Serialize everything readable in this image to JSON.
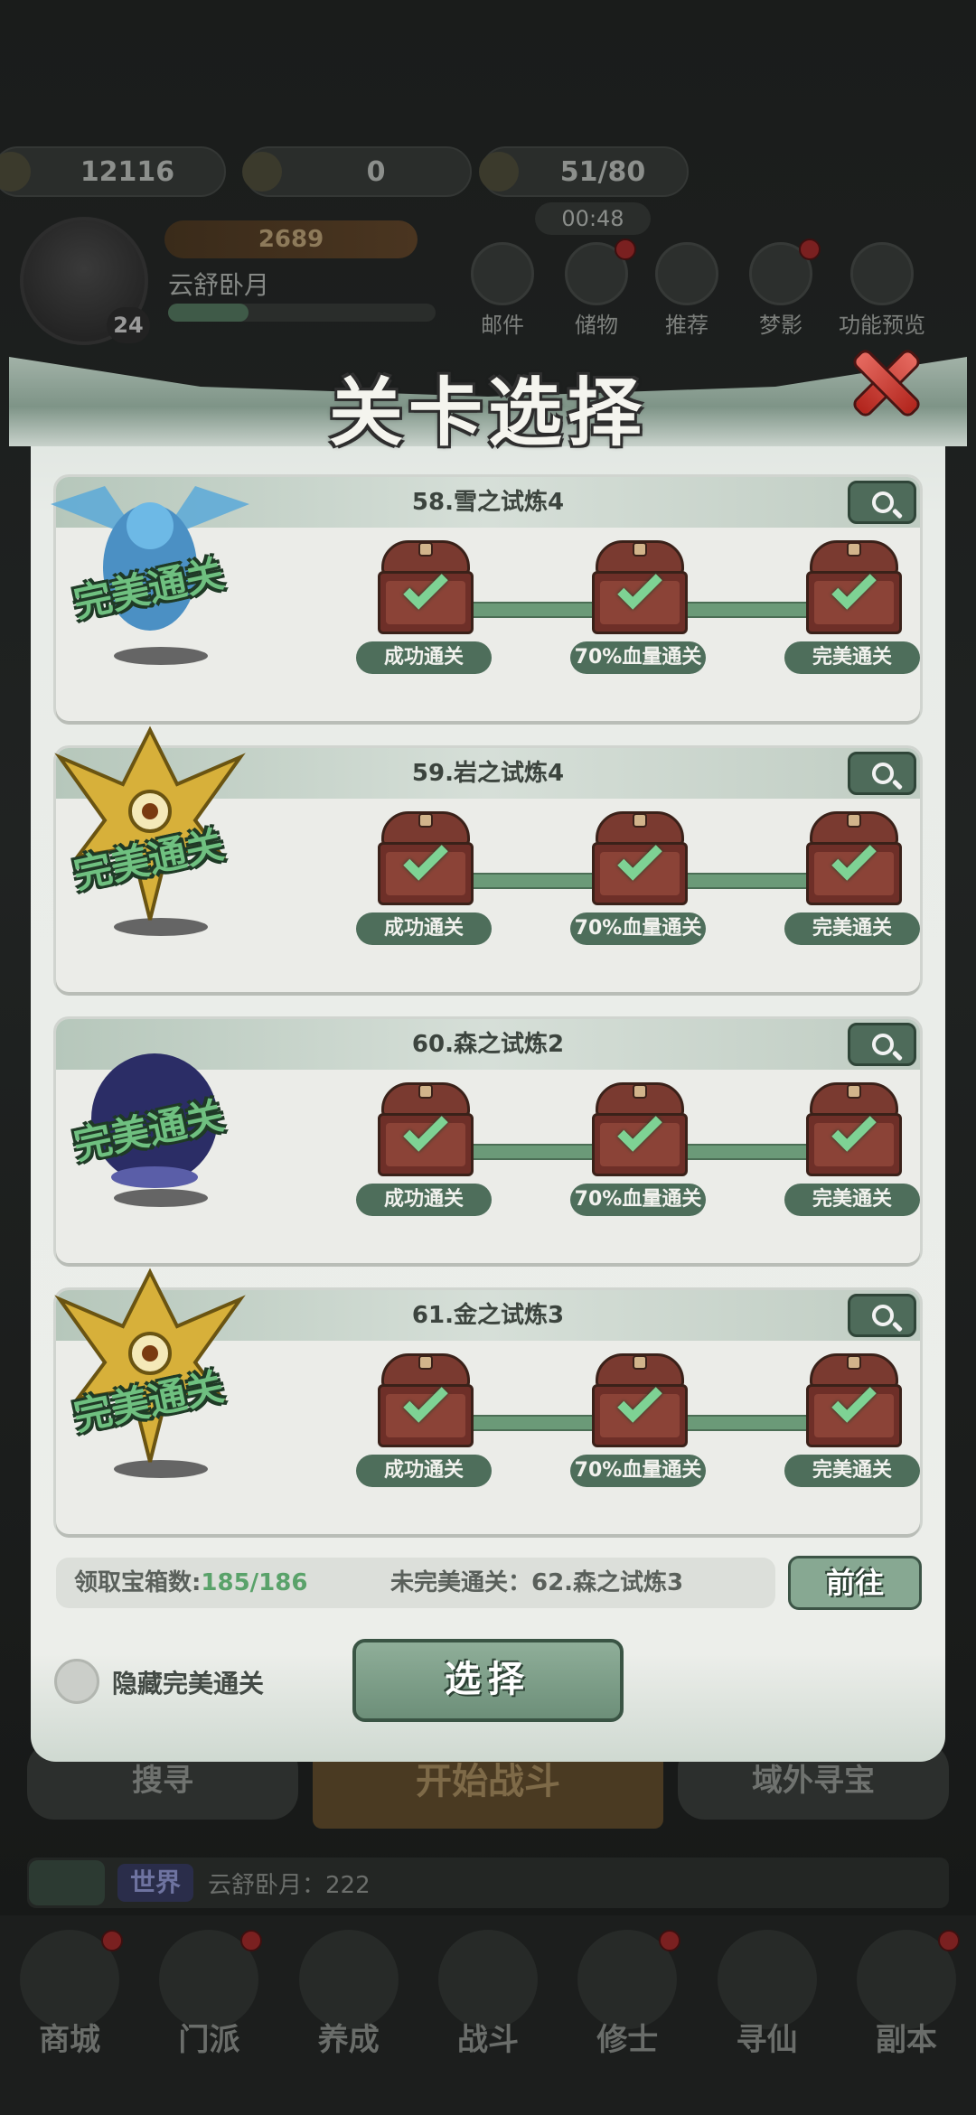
{
  "resources": [
    {
      "icon": "coin-icon",
      "value": "12116"
    },
    {
      "icon": "ticket-icon",
      "value": "0"
    },
    {
      "icon": "stamina-icon",
      "value": "51/80"
    }
  ],
  "timer": "00:48",
  "player": {
    "level": "24",
    "power": "2689",
    "name": "云舒卧月"
  },
  "top_buttons": [
    {
      "icon": "mail-icon",
      "label": "邮件"
    },
    {
      "icon": "storage-icon",
      "label": "储物"
    },
    {
      "icon": "recommend-icon",
      "label": "推荐"
    },
    {
      "icon": "dream-icon",
      "label": "梦影"
    },
    {
      "icon": "preview-icon",
      "label": "功能预览"
    }
  ],
  "battle": {
    "left_label": "搜寻",
    "start_label": "开始战斗",
    "right_label": "域外寻宝"
  },
  "chat": {
    "channel": "世界",
    "message": "云舒卧月：222"
  },
  "nav": [
    {
      "icon": "shop-icon",
      "label": "商城"
    },
    {
      "icon": "sect-icon",
      "label": "门派"
    },
    {
      "icon": "cultivate-icon",
      "label": "养成"
    },
    {
      "icon": "battle-icon",
      "label": "战斗"
    },
    {
      "icon": "cultivator-icon",
      "label": "修士"
    },
    {
      "icon": "seek-immortal-icon",
      "label": "寻仙"
    },
    {
      "icon": "dungeon-icon",
      "label": "副本"
    }
  ],
  "modal": {
    "title": "关卡选择",
    "perfect_stamp": "完美通关",
    "reward_labels": [
      "成功通关",
      "70%血量通关",
      "完美通关"
    ],
    "stages": [
      {
        "title": "58.雪之试炼4",
        "boss": "snow-beast",
        "accent": "#5aa9d8"
      },
      {
        "title": "59.岩之试炼4",
        "boss": "rock-eye",
        "accent": "#d7b03a"
      },
      {
        "title": "60.森之试炼2",
        "boss": "forest-shade",
        "accent": "#3c3f8a"
      },
      {
        "title": "61.金之试炼3",
        "boss": "gold-eye",
        "accent": "#d7b03a"
      }
    ],
    "summary": {
      "chest_label": "领取宝箱数:",
      "chest_value": "185/186",
      "unfinished": "未完美通关：62.森之试炼3"
    },
    "goto_label": "前往",
    "hide_label": "隐藏完美通关",
    "select_label": "选择"
  }
}
